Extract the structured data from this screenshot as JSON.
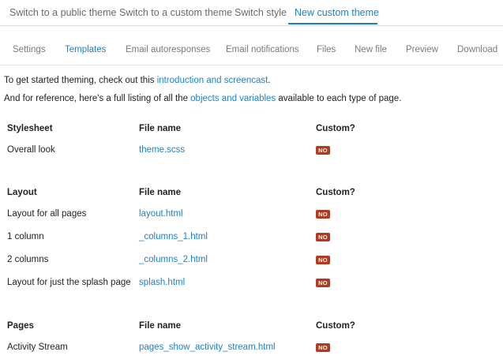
{
  "top_tabs": [
    {
      "label": "Switch to a public theme"
    },
    {
      "label": "Switch to a custom theme"
    },
    {
      "label": "Switch style"
    },
    {
      "label": "New custom theme"
    }
  ],
  "sub_tabs": [
    {
      "label": "Settings"
    },
    {
      "label": "Templates"
    },
    {
      "label": "Email autoresponses"
    },
    {
      "label": "Email notifications"
    },
    {
      "label": "Files"
    },
    {
      "label": "New file"
    },
    {
      "label": "Preview"
    },
    {
      "label": "Download"
    }
  ],
  "intro": {
    "line1_prefix": "To get started theming, check out this ",
    "line1_link": "introduction and screencast",
    "line1_suffix": ".",
    "line2_prefix": "And for reference, here's a full listing of all the ",
    "line2_link": "objects and variables",
    "line2_suffix": " available to each type of page."
  },
  "sections": [
    {
      "title": "Stylesheet",
      "file_header": "File name",
      "custom_header": "Custom?",
      "rows": [
        {
          "name": "Overall look",
          "file": "theme.scss",
          "custom": "NO"
        }
      ]
    },
    {
      "title": "Layout",
      "file_header": "File name",
      "custom_header": "Custom?",
      "rows": [
        {
          "name": "Layout for all pages",
          "file": "layout.html",
          "custom": "NO"
        },
        {
          "name": "1 column",
          "file": "_columns_1.html",
          "custom": "NO"
        },
        {
          "name": "2 columns",
          "file": "_columns_2.html",
          "custom": "NO"
        },
        {
          "name": "Layout for just the splash page",
          "file": "splash.html",
          "custom": "NO"
        }
      ]
    },
    {
      "title": "Pages",
      "file_header": "File name",
      "custom_header": "Custom?",
      "rows": [
        {
          "name": "Activity Stream",
          "file": "pages_show_activity_stream.html",
          "custom": "NO"
        }
      ]
    }
  ],
  "colors": {
    "accent": "#1f7fc6",
    "badge": "#b33a1e"
  }
}
